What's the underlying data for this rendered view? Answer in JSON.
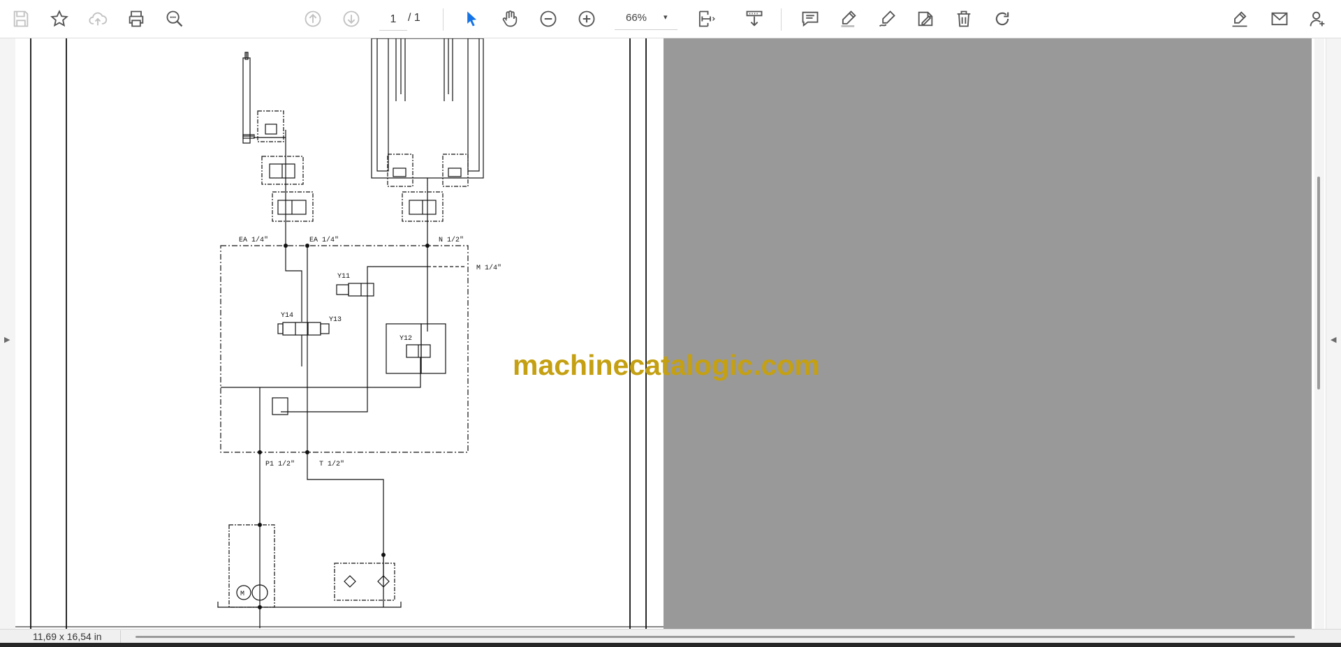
{
  "toolbar": {
    "page_current": "1",
    "page_total": "/ 1",
    "zoom": "66%",
    "zoom_caret": "▾",
    "icons": [
      "save-icon",
      "star-icon",
      "cloud-upload-icon",
      "print-icon",
      "zoom-search-icon",
      "page-up-icon",
      "page-down-icon",
      "select-cursor-icon",
      "hand-icon",
      "zoom-out-icon",
      "zoom-in-icon",
      "fit-page-icon",
      "scroll-mode-icon",
      "comment-icon",
      "highlight-icon",
      "draw-icon",
      "stamp-icon",
      "delete-icon",
      "rotate-icon",
      "sign-icon",
      "email-icon",
      "add-user-icon"
    ]
  },
  "document": {
    "watermark": "machinecatalogic.com",
    "labels": {
      "port_ea1": "EA 1/4\"",
      "port_ea2": "EA 1/4\"",
      "port_n": "N 1/2\"",
      "port_m": "M 1/4\"",
      "y11": "Y11",
      "y12": "Y12",
      "y13": "Y13",
      "y14": "Y14",
      "port_p1": "P1 1/2\"",
      "port_t": "T 1/2\"",
      "motor": "M"
    }
  },
  "status": {
    "page_size": "11,69 x 16,54 in"
  },
  "rails": {
    "left_arrow": "▶",
    "right_arrow": "◀"
  },
  "colors": {
    "accent_blue": "#1473e6",
    "watermark": "#c4a012",
    "gray_canvas": "#999999"
  }
}
